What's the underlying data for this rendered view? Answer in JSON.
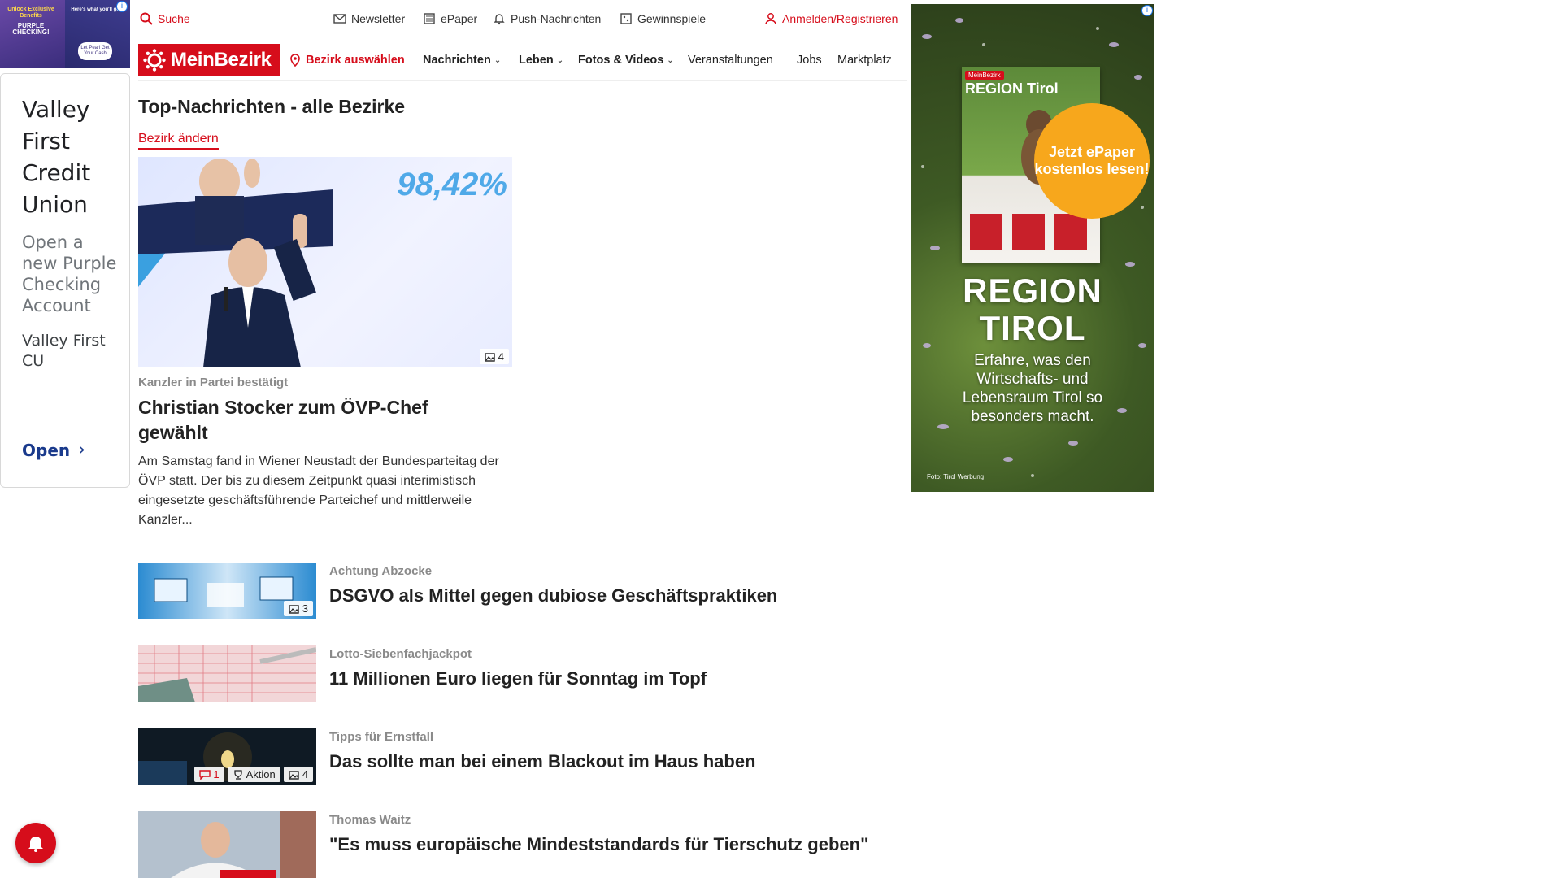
{
  "left_ad": {
    "banner": {
      "line1": "Unlock Exclusive Benefits",
      "line2": "Here's what you'll get",
      "product": "PURPLE CHECKING!",
      "badge": "Let Pearl Get Your Cash"
    },
    "title": "Valley First Credit Union",
    "description": "Open a new Purple Checking Account",
    "advertiser": "Valley First CU",
    "cta": "Open"
  },
  "utility": {
    "search": "Suche",
    "newsletter": "Newsletter",
    "epaper": "ePaper",
    "push": "Push-Nachrichten",
    "gewinnspiele": "Gewinnspiele",
    "login": "Anmelden/Registrieren"
  },
  "nav": {
    "logo": "MeinBezirk",
    "bezirk": "Bezirk auswählen",
    "items": [
      {
        "label": "Nachrichten",
        "dropdown": true
      },
      {
        "label": "Leben",
        "dropdown": true
      },
      {
        "label": "Fotos & Videos",
        "dropdown": true
      },
      {
        "label": "Veranstaltungen",
        "dropdown": false
      },
      {
        "label": "Jobs",
        "dropdown": false
      },
      {
        "label": "Marktplatz",
        "dropdown": false
      }
    ]
  },
  "main": {
    "section_title": "Top-Nachrichten - alle Bezirke",
    "change_bezirk": "Bezirk ändern",
    "hero": {
      "image_text": "98,42%",
      "photos": "4",
      "kicker": "Kanzler in Partei bestätigt",
      "title": "Christian Stocker zum ÖVP-Chef gewählt",
      "text": "Am Samstag fand in Wiener Neustadt der Bundesparteitag der ÖVP statt. Der bis zu diesem Zeitpunkt quasi interimistisch eingesetzte geschäftsführende Parteichef und mittlerweile Kanzler..."
    },
    "articles": [
      {
        "kicker": "Achtung Abzocke",
        "title": "DSGVO als Mittel gegen dubiose Geschäftspraktiken",
        "photos": "3"
      },
      {
        "kicker": "Lotto-Siebenfachjackpot",
        "title": "11 Millionen Euro liegen für Sonntag im Topf"
      },
      {
        "kicker": "Tipps für Ernstfall",
        "title": "Das sollte man bei einem Blackout im Haus haben",
        "comments": "1",
        "aktion": "Aktion",
        "photos": "4"
      },
      {
        "kicker": "Thomas Waitz",
        "title": "\"Es muss europäische Mindeststandards für Tierschutz geben\""
      }
    ]
  },
  "right_ad": {
    "brand": "MeinBezirk",
    "mag_title": "REGION Tirol",
    "circle": "Jetzt ePaper kostenlos lesen!",
    "big1": "REGION",
    "big2": "TIROL",
    "sub": "Erfahre, was den Wirtschafts- und Lebensraum Tirol so besonders macht.",
    "credit": "Foto: Tirol Werbung"
  },
  "colors": {
    "brand": "#d60d1b",
    "accent_orange": "#f7a71c"
  }
}
